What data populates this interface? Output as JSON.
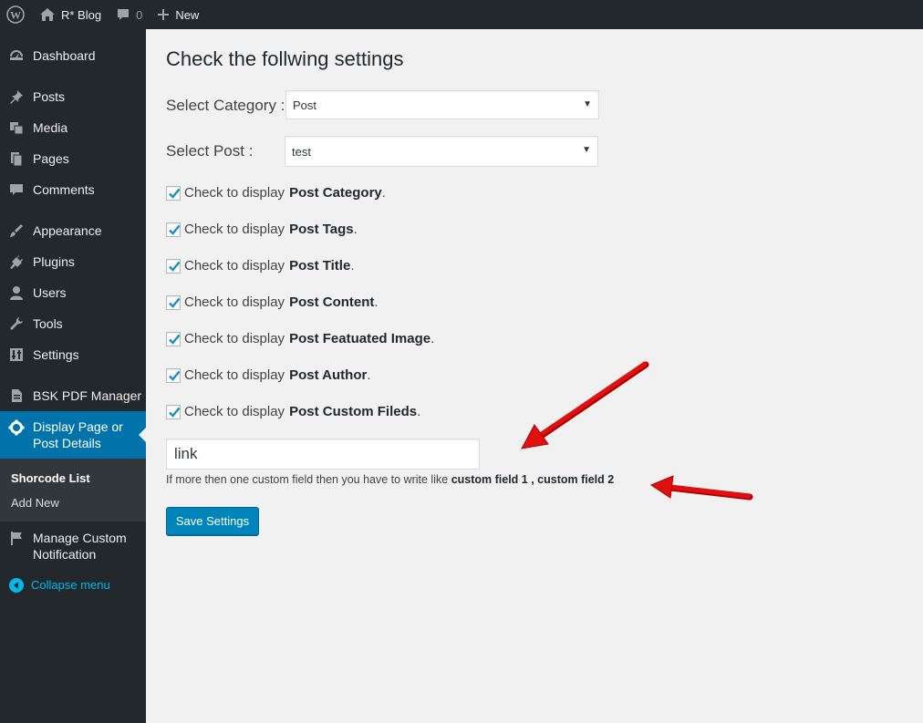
{
  "adminbar": {
    "site_name": "R* Blog",
    "comment_count": "0",
    "new_label": "New"
  },
  "sidebar": {
    "items": [
      {
        "label": "Dashboard",
        "icon": "dashboard-icon"
      },
      {
        "label": "Posts",
        "icon": "pin-icon"
      },
      {
        "label": "Media",
        "icon": "media-icon"
      },
      {
        "label": "Pages",
        "icon": "pages-icon"
      },
      {
        "label": "Comments",
        "icon": "comment-icon"
      },
      {
        "label": "Appearance",
        "icon": "brush-icon"
      },
      {
        "label": "Plugins",
        "icon": "plug-icon"
      },
      {
        "label": "Users",
        "icon": "user-icon"
      },
      {
        "label": "Tools",
        "icon": "wrench-icon"
      },
      {
        "label": "Settings",
        "icon": "settings-icon"
      },
      {
        "label": "BSK PDF Manager",
        "icon": "document-icon"
      },
      {
        "label": "Display Page or Post Details",
        "icon": "gear-icon"
      },
      {
        "label": "Manage Custom Notification",
        "icon": "flag-icon"
      }
    ],
    "submenu": [
      {
        "label": "Shorcode List"
      },
      {
        "label": "Add New"
      }
    ],
    "collapse_label": "Collapse menu"
  },
  "main": {
    "title": "Check the follwing settings",
    "category_label": "Select Category :",
    "category_value": "Post",
    "post_label": "Select Post :",
    "post_value": "test",
    "checkboxes": [
      {
        "prefix": "Check to display",
        "bold": "Post Category",
        "checked": true
      },
      {
        "prefix": "Check to display",
        "bold": "Post Tags",
        "checked": true
      },
      {
        "prefix": "Check to display",
        "bold": "Post Title",
        "checked": true
      },
      {
        "prefix": "Check to display",
        "bold": "Post Content",
        "checked": true
      },
      {
        "prefix": "Check to display",
        "bold": "Post Featuated Image",
        "checked": true
      },
      {
        "prefix": "Check to display",
        "bold": "Post Author",
        "checked": true
      },
      {
        "prefix": "Check to display",
        "bold": "Post Custom Fileds",
        "checked": true
      }
    ],
    "custom_field_value": "link",
    "help_text": "If more then one custom field then you have to write like",
    "help_example": "custom field 1 , custom field 2",
    "save_label": "Save Settings"
  },
  "colors": {
    "adminbar_bg": "#23282d",
    "active_menu": "#0073aa",
    "button": "#0085ba",
    "annotation_arrow": "#e01010"
  }
}
